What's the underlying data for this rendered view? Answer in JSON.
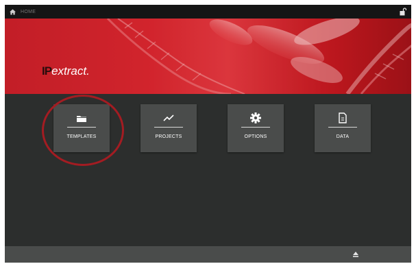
{
  "topbar": {
    "home_label": "HOME",
    "home_icon": "home-icon",
    "lock_icon": "lock-icon"
  },
  "banner": {
    "logo_ip": "IP",
    "logo_text": "extract."
  },
  "tiles": [
    {
      "label": "TEMPLATES",
      "icon": "folder-icon",
      "highlighted": true
    },
    {
      "label": "PROJECTS",
      "icon": "chart-line-icon"
    },
    {
      "label": "OPTIONS",
      "icon": "gear-icon"
    },
    {
      "label": "DATA",
      "icon": "document-icon"
    }
  ],
  "bottombar": {
    "eject_icon": "eject-icon"
  },
  "colors": {
    "accent": "#c8202a",
    "background": "#2c2e2d",
    "tile": "#4a4c4b",
    "highlight_ring": "#a31c22"
  }
}
